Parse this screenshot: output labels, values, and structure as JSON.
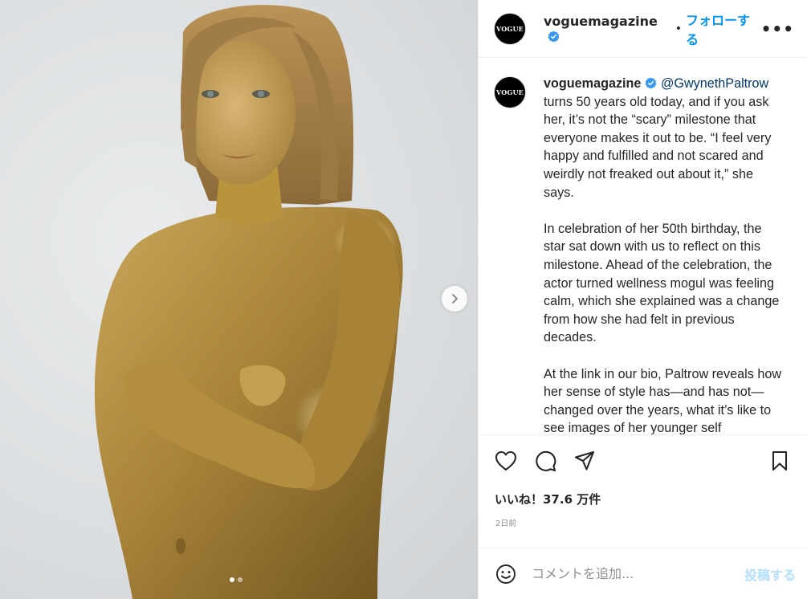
{
  "header": {
    "avatar_text": "VOGUE",
    "username": "voguemagazine",
    "separator": "•",
    "follow_label": "フォローする",
    "more_label": "•••"
  },
  "caption": {
    "avatar_text": "VOGUE",
    "username": "voguemagazine",
    "mention": "@GwynethPaltrow",
    "paragraph1_rest": " turns 50 years old today, and if you ask her, it’s not the “scary” milestone that everyone makes it out to be. “I feel very happy and fulfilled and not scared and weirdly not freaked out about it,” she says.",
    "paragraph2": "In celebration of her 50th birthday, the star sat down with us to reflect on this milestone. Ahead of the celebration, the actor turned wellness mogul was feeling calm, which she explained was a change from how she had felt in previous decades.",
    "paragraph3": "At the link in our bio, Paltrow reveals how her sense of style has—and has not—changed over the years, what it’s like to see images of her younger self"
  },
  "actions": {
    "like_icon": "heart-icon",
    "comment_icon": "comment-icon",
    "share_icon": "paper-plane-icon",
    "save_icon": "bookmark-icon"
  },
  "likes": {
    "text": "いいね！37.6 万件"
  },
  "timestamp": "2日前",
  "comment": {
    "placeholder": "コメントを追加...",
    "post_label": "投稿する"
  },
  "media": {
    "carousel_total": 2,
    "carousel_index": 1
  },
  "colors": {
    "accent": "#0095f6",
    "verified": "#3897f0",
    "post_disabled": "#b2dffc",
    "gold": "#b08a3a"
  }
}
